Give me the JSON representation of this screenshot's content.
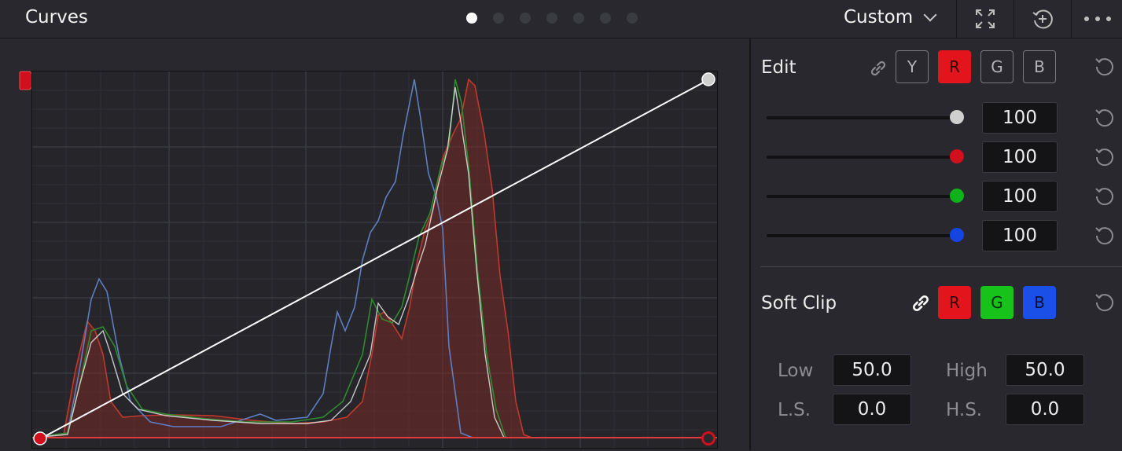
{
  "header": {
    "title": "Curves",
    "preset": "Custom",
    "page_dots": 7,
    "active_page": 0
  },
  "edit": {
    "label": "Edit",
    "channels": [
      "Y",
      "R",
      "G",
      "B"
    ],
    "active_channel": "R",
    "sliders": [
      {
        "channel": "master",
        "value": "100",
        "color": "#cfcfcf"
      },
      {
        "channel": "red",
        "value": "100",
        "color": "#d0101c"
      },
      {
        "channel": "green",
        "value": "100",
        "color": "#10b21a"
      },
      {
        "channel": "blue",
        "value": "100",
        "color": "#1545e0"
      }
    ]
  },
  "soft_clip": {
    "label": "Soft Clip",
    "channels": [
      "R",
      "G",
      "B"
    ],
    "low_label": "Low",
    "low_value": "50.0",
    "high_label": "High",
    "high_value": "50.0",
    "ls_label": "L.S.",
    "ls_value": "0.0",
    "hs_label": "H.S.",
    "hs_value": "0.0"
  },
  "colors": {
    "red_chip": "#e3141c",
    "green_chip": "#17c31a",
    "blue_chip": "#1a4fe8",
    "red_hist": "#c0392b",
    "green_hist": "#2e8b2e",
    "blue_hist": "#5c7fc4"
  }
}
